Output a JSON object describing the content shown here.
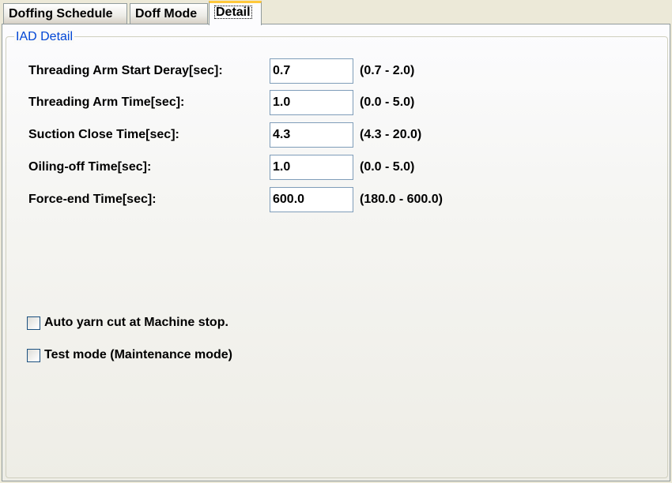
{
  "tabs": [
    {
      "label": "Doffing Schedule",
      "active": false
    },
    {
      "label": "Doff Mode",
      "active": false
    },
    {
      "label": "Detail",
      "active": true
    }
  ],
  "group": {
    "title": "IAD Detail"
  },
  "fields": [
    {
      "label": "Threading Arm  Start Deray[sec]:",
      "value": "0.7",
      "range": "(0.7 - 2.0)"
    },
    {
      "label": "Threading Arm Time[sec]:",
      "value": "1.0",
      "range": "(0.0 - 5.0)"
    },
    {
      "label": "Suction Close Time[sec]:",
      "value": "4.3",
      "range": "(4.3 - 20.0)"
    },
    {
      "label": "Oiling-off Time[sec]:",
      "value": "1.0",
      "range": "(0.0 - 5.0)"
    },
    {
      "label": "Force-end Time[sec]:",
      "value": "600.0",
      "range": "(180.0 - 600.0)"
    }
  ],
  "checkboxes": [
    {
      "label": "Auto yarn cut at Machine stop.",
      "checked": false
    },
    {
      "label": "Test mode (Maintenance mode)",
      "checked": false
    }
  ],
  "colors": {
    "group_title": "#0046d5",
    "active_tab_accent": "#ffc83c",
    "window_background": "#ece9d8"
  }
}
